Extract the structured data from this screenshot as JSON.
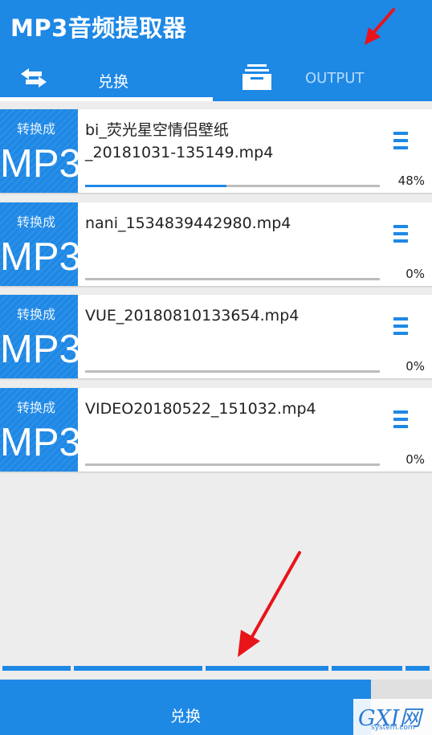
{
  "app": {
    "title": "MP3音频提取器"
  },
  "tabs": [
    {
      "label": "兑换",
      "icon": "swap-icon"
    },
    {
      "label": "OUTPUT",
      "icon": "stack-icon"
    }
  ],
  "files": [
    {
      "badge_small": "转换成",
      "badge_big": "MP3",
      "name": "bi_荧光星空情侣壁纸\n_20181031-135149.mp4",
      "progress": 48,
      "percent_label": "48%"
    },
    {
      "badge_small": "转换成",
      "badge_big": "MP3",
      "name": "nani_1534839442980.mp4",
      "progress": 0,
      "percent_label": "0%"
    },
    {
      "badge_small": "转换成",
      "badge_big": "MP3",
      "name": "VUE_20180810133654.mp4",
      "progress": 0,
      "percent_label": "0%"
    },
    {
      "badge_small": "转换成",
      "badge_big": "MP3",
      "name": "VIDEO20180522_151032.mp4",
      "progress": 0,
      "percent_label": "0%"
    }
  ],
  "bottom": {
    "button_label": "兑换"
  },
  "watermark": {
    "main": "GXI网",
    "sub": "system.com"
  },
  "colors": {
    "primary": "#1e88e5",
    "annotation": "#e8141a"
  }
}
